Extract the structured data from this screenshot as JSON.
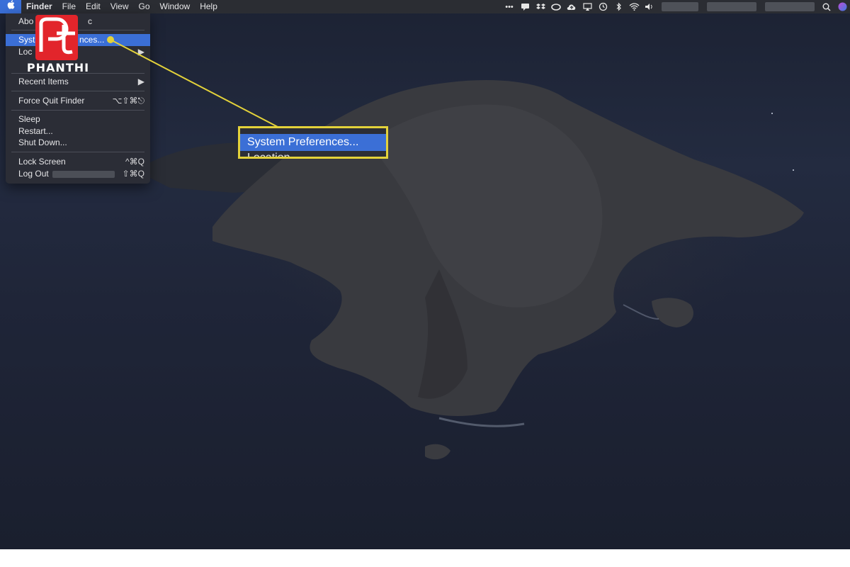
{
  "menubar": {
    "apple_icon": "apple-icon",
    "items": [
      "Finder",
      "File",
      "Edit",
      "View",
      "Go",
      "Window",
      "Help"
    ],
    "status_icons": [
      "more-dots-icon",
      "message-icon",
      "dropbox-icon",
      "creative-cloud-icon",
      "cloud-upload-icon",
      "airplay-icon",
      "time-machine-icon",
      "bluetooth-icon",
      "wifi-icon",
      "volume-icon",
      "search-icon",
      "siri-icon"
    ]
  },
  "apple_menu": {
    "about": "Abo",
    "about_tail": "c",
    "system_preferences": "Syst",
    "system_preferences_tail": "nces...",
    "location": "Loc",
    "recent_items": "Recent Items",
    "force_quit": "Force Quit Finder",
    "force_quit_shortcut": "⌥⇧⌘⎋",
    "sleep": "Sleep",
    "restart": "Restart...",
    "shut_down": "Shut Down...",
    "lock_screen": "Lock Screen",
    "lock_screen_shortcut": "^⌘Q",
    "log_out": "Log Out",
    "log_out_shortcut": "⇧⌘Q"
  },
  "callout": {
    "highlighted": "System Preferences...",
    "next": "Location"
  },
  "logo": {
    "wordmark": "PHANTHI"
  },
  "colors": {
    "highlight": "#3b6fd6",
    "callout_border": "#e3d23a",
    "logo_red": "#e2252b"
  }
}
